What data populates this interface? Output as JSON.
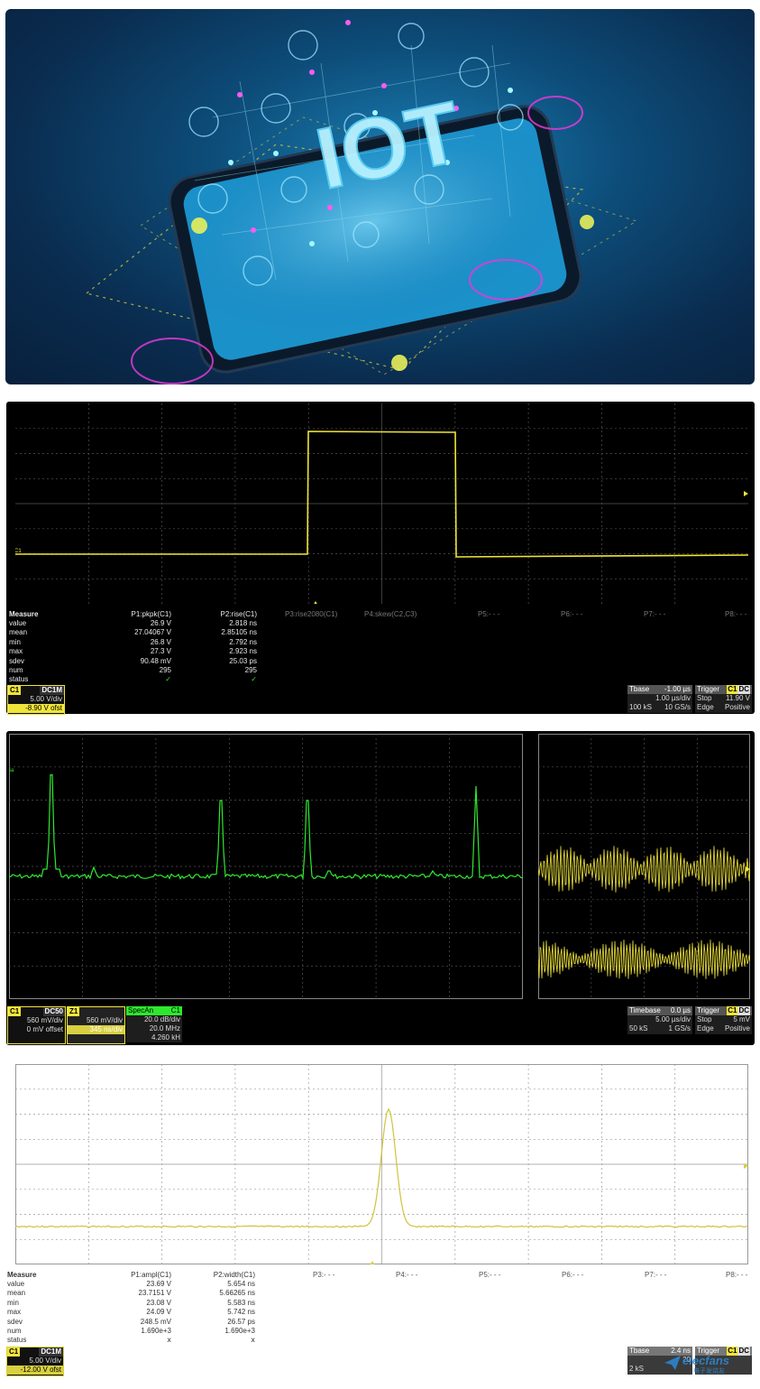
{
  "hero": {
    "title": "IOT"
  },
  "colors": {
    "yellow": "#f0e43a",
    "green": "#2ee82e",
    "grid": "#555555",
    "trace_light": "#d8d040"
  },
  "scope1": {
    "channel_label": "C1",
    "measure": {
      "header": "Measure",
      "rows": [
        "value",
        "mean",
        "min",
        "max",
        "sdev",
        "num",
        "status"
      ],
      "p1": {
        "title": "P1:pkpk(C1)",
        "values": [
          "26.9 V",
          "27.04067 V",
          "26.8 V",
          "27.3 V",
          "90.48 mV",
          "295",
          "✓"
        ]
      },
      "p2": {
        "title": "P2:rise(C1)",
        "values": [
          "2.818 ns",
          "2.85105 ns",
          "2.792 ns",
          "2.923 ns",
          "25.03 ps",
          "295",
          "✓"
        ]
      },
      "p3": "P3:rise2080(C1)",
      "p4": "P4:skew(C2,C3)",
      "p5": "P5:- - -",
      "p6": "P6:- - -",
      "p7": "P7:- - -",
      "p8": "P8:- - -"
    },
    "ch_box": {
      "name": "C1",
      "coupling": "DC1M",
      "vdiv": "5.00 V/div",
      "offset": "-8.90 V ofst"
    },
    "tbase": {
      "label": "Tbase",
      "delay": "-1.00 µs",
      "tdiv": "1.00 µs/div",
      "samples": "100 kS",
      "rate": "10 GS/s"
    },
    "trigger": {
      "label": "Trigger",
      "src": "C1",
      "coup": "DC",
      "mode": "Stop",
      "level": "11.90 V",
      "type": "Edge",
      "slope": "Positive"
    }
  },
  "scope2": {
    "trace_label_left": "Sa",
    "trace_label_c1": "C1",
    "trace_label_z1": "Z1",
    "ch_box": {
      "name": "C1",
      "coupling": "DC50",
      "vdiv": "560 mV/div",
      "offset": "0 mV offset"
    },
    "z1_box": {
      "name": "Z1",
      "vdiv": "560 mV/div",
      "tdiv": "345 ns/div"
    },
    "spec_box": {
      "name": "SpecAn",
      "src": "C1",
      "ddiv": "20.0 dB/div",
      "center": "20.0 MHz",
      "rbw": "4.260 kH"
    },
    "tbase": {
      "label": "Timebase",
      "delay": "0.0 µs",
      "tdiv": "5.00 µs/div",
      "samples": "50 kS",
      "rate": "1 GS/s"
    },
    "trigger": {
      "label": "Trigger",
      "src": "C1",
      "coup": "DC",
      "mode": "Stop",
      "level": "5 mV",
      "type": "Edge",
      "slope": "Positive"
    }
  },
  "scope3": {
    "channel_label": "C1",
    "measure": {
      "header": "Measure",
      "rows": [
        "value",
        "mean",
        "min",
        "max",
        "sdev",
        "num",
        "status"
      ],
      "p1": {
        "title": "P1:ampl(C1)",
        "values": [
          "23.69 V",
          "23.7151 V",
          "23.08 V",
          "24.09 V",
          "248.5 mV",
          "1.690e+3",
          "ⅹ"
        ]
      },
      "p2": {
        "title": "P2:width(C1)",
        "values": [
          "5.654 ns",
          "5.66265 ns",
          "5.583 ns",
          "5.742 ns",
          "26.57 ps",
          "1.690e+3",
          "ⅹ"
        ]
      },
      "p3": "P3:- - -",
      "p4": "P4:- - -",
      "p5": "P5:- - -",
      "p6": "P6:- - -",
      "p7": "P7:- - -",
      "p8": "P8:- - -"
    },
    "ch_box": {
      "name": "C1",
      "coupling": "DC1M",
      "vdiv": "5.00 V/div",
      "offset": "-12.00 V ofst"
    },
    "tbase": {
      "label": "Tbase",
      "delay": "2.4 ns",
      "tdiv": "20",
      "samples": "2 kS"
    },
    "trigger": {
      "label": "Trigger",
      "src": "C1",
      "coup": "DC"
    }
  },
  "watermark": {
    "text": "elecfans",
    "sub": "电子发烧友"
  }
}
